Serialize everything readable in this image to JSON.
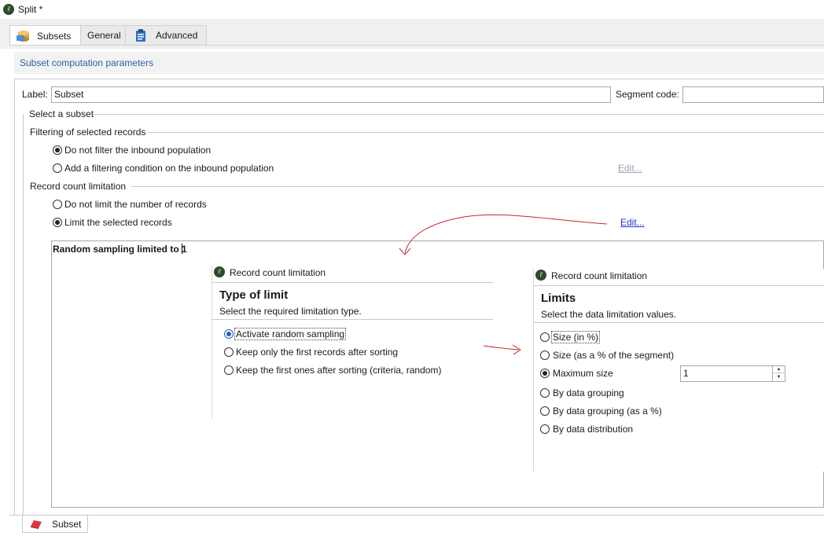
{
  "window": {
    "title": "Split *"
  },
  "tabs": [
    {
      "label": "Subsets",
      "icon": "database-icon",
      "active": true
    },
    {
      "label": "General",
      "active": false
    },
    {
      "label": "Advanced",
      "icon": "clipboard-icon",
      "active": false
    }
  ],
  "section_header": "Subset computation parameters",
  "fields": {
    "label_caption": "Label:",
    "label_value": "Subset",
    "segment_caption": "Segment code:",
    "segment_value": ""
  },
  "select_subset": "Select a subset",
  "filtering": {
    "title": "Filtering of selected records",
    "options": [
      {
        "label": "Do not filter the inbound population",
        "checked": true
      },
      {
        "label": "Add a filtering condition on the inbound population",
        "checked": false
      }
    ],
    "edit_label": "Edit..."
  },
  "record_count": {
    "title": "Record count limitation",
    "options": [
      {
        "label": "Do not limit the number of records",
        "checked": false
      },
      {
        "label": "Limit the selected records",
        "checked": true
      }
    ],
    "edit_label": "Edit..."
  },
  "summary_text": "Random sampling limited to 1",
  "type_panel": {
    "window_title": "Record count limitation",
    "heading": "Type of limit",
    "subheading": "Select the required limitation type.",
    "options": [
      {
        "label": "Activate random sampling",
        "checked": true
      },
      {
        "label": "Keep only the first records after sorting",
        "checked": false
      },
      {
        "label": "Keep the first ones after sorting (criteria, random)",
        "checked": false
      }
    ]
  },
  "limits_panel": {
    "window_title": "Record count limitation",
    "heading": "Limits",
    "subheading": "Select the data limitation values.",
    "options": [
      {
        "label": "Size (in %)",
        "checked": false
      },
      {
        "label": "Size (as a % of the segment)",
        "checked": false
      },
      {
        "label": "Maximum size",
        "checked": true
      },
      {
        "label": "By data grouping",
        "checked": false
      },
      {
        "label": "By data grouping (as a %)",
        "checked": false
      },
      {
        "label": "By data distribution",
        "checked": false
      }
    ],
    "max_size_value": "1"
  },
  "bottom_tab": {
    "label": "Subset",
    "icon": "subset-icon"
  },
  "colors": {
    "link": "#2433c4",
    "header_text": "#2e5fa3",
    "annotation": "#c0282d",
    "radio_selected": "#1c62b9"
  }
}
